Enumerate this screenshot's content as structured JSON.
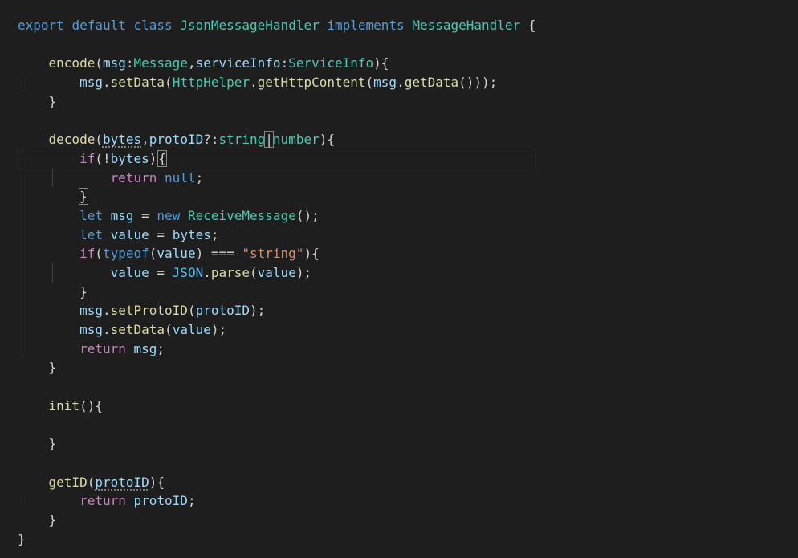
{
  "code": {
    "lines": [
      [
        {
          "t": "export",
          "c": "kw"
        },
        {
          "t": " ",
          "c": "pl"
        },
        {
          "t": "default",
          "c": "kw"
        },
        {
          "t": " ",
          "c": "pl"
        },
        {
          "t": "class",
          "c": "kw"
        },
        {
          "t": " ",
          "c": "pl"
        },
        {
          "t": "JsonMessageHandler",
          "c": "ty"
        },
        {
          "t": " ",
          "c": "pl"
        },
        {
          "t": "implements",
          "c": "kw"
        },
        {
          "t": " ",
          "c": "pl"
        },
        {
          "t": "MessageHandler",
          "c": "ty"
        },
        {
          "t": " {",
          "c": "pl"
        }
      ],
      [],
      [
        {
          "t": "    ",
          "c": "pl"
        },
        {
          "t": "encode",
          "c": "fn"
        },
        {
          "t": "(",
          "c": "pl"
        },
        {
          "t": "msg",
          "c": "vr"
        },
        {
          "t": ":",
          "c": "pl"
        },
        {
          "t": "Message",
          "c": "ty"
        },
        {
          "t": ",",
          "c": "pl"
        },
        {
          "t": "serviceInfo",
          "c": "vr"
        },
        {
          "t": ":",
          "c": "pl"
        },
        {
          "t": "ServiceInfo",
          "c": "ty"
        },
        {
          "t": "){",
          "c": "pl"
        }
      ],
      [
        {
          "t": "        ",
          "c": "pl"
        },
        {
          "t": "msg",
          "c": "vr"
        },
        {
          "t": ".",
          "c": "pl"
        },
        {
          "t": "setData",
          "c": "fn"
        },
        {
          "t": "(",
          "c": "pl"
        },
        {
          "t": "HttpHelper",
          "c": "ty"
        },
        {
          "t": ".",
          "c": "pl"
        },
        {
          "t": "getHttpContent",
          "c": "fn"
        },
        {
          "t": "(",
          "c": "pl"
        },
        {
          "t": "msg",
          "c": "vr"
        },
        {
          "t": ".",
          "c": "pl"
        },
        {
          "t": "getData",
          "c": "fn"
        },
        {
          "t": "()));",
          "c": "pl"
        }
      ],
      [
        {
          "t": "    }",
          "c": "pl"
        }
      ],
      [],
      [
        {
          "t": "    ",
          "c": "pl"
        },
        {
          "t": "decode",
          "c": "fn"
        },
        {
          "t": "(",
          "c": "pl"
        },
        {
          "t": "bytes",
          "c": "vr",
          "sq": true
        },
        {
          "t": ",",
          "c": "pl"
        },
        {
          "t": "protoID",
          "c": "vr"
        },
        {
          "t": "?:",
          "c": "pl"
        },
        {
          "t": "string",
          "c": "ty"
        },
        {
          "t": "|",
          "c": "pl",
          "bm": true
        },
        {
          "t": "number",
          "c": "ty"
        },
        {
          "t": "){",
          "c": "pl"
        }
      ],
      [
        {
          "t": "        ",
          "c": "pl"
        },
        {
          "t": "if",
          "c": "ctl"
        },
        {
          "t": "(!",
          "c": "pl"
        },
        {
          "t": "bytes",
          "c": "vr"
        },
        {
          "t": ")",
          "c": "pl"
        },
        {
          "t": "{",
          "c": "pl",
          "bm": true,
          "cur": true
        }
      ],
      [
        {
          "t": "            ",
          "c": "pl"
        },
        {
          "t": "return",
          "c": "ctl"
        },
        {
          "t": " ",
          "c": "pl"
        },
        {
          "t": "null",
          "c": "kw"
        },
        {
          "t": ";",
          "c": "pl"
        }
      ],
      [
        {
          "t": "        ",
          "c": "pl"
        },
        {
          "t": "}",
          "c": "pl",
          "bm": true
        }
      ],
      [
        {
          "t": "        ",
          "c": "pl"
        },
        {
          "t": "let",
          "c": "kw"
        },
        {
          "t": " ",
          "c": "pl"
        },
        {
          "t": "msg",
          "c": "vr"
        },
        {
          "t": " = ",
          "c": "pl"
        },
        {
          "t": "new",
          "c": "kw"
        },
        {
          "t": " ",
          "c": "pl"
        },
        {
          "t": "ReceiveMessage",
          "c": "ty"
        },
        {
          "t": "();",
          "c": "pl"
        }
      ],
      [
        {
          "t": "        ",
          "c": "pl"
        },
        {
          "t": "let",
          "c": "kw"
        },
        {
          "t": " ",
          "c": "pl"
        },
        {
          "t": "value",
          "c": "vr"
        },
        {
          "t": " = ",
          "c": "pl"
        },
        {
          "t": "bytes",
          "c": "vr"
        },
        {
          "t": ";",
          "c": "pl"
        }
      ],
      [
        {
          "t": "        ",
          "c": "pl"
        },
        {
          "t": "if",
          "c": "ctl"
        },
        {
          "t": "(",
          "c": "pl"
        },
        {
          "t": "typeof",
          "c": "kw"
        },
        {
          "t": "(",
          "c": "pl"
        },
        {
          "t": "value",
          "c": "vr"
        },
        {
          "t": ") === ",
          "c": "pl"
        },
        {
          "t": "\"string\"",
          "c": "str"
        },
        {
          "t": "){",
          "c": "pl"
        }
      ],
      [
        {
          "t": "            ",
          "c": "pl"
        },
        {
          "t": "value",
          "c": "vr"
        },
        {
          "t": " = ",
          "c": "pl"
        },
        {
          "t": "JSON",
          "c": "cnst"
        },
        {
          "t": ".",
          "c": "pl"
        },
        {
          "t": "parse",
          "c": "fn"
        },
        {
          "t": "(",
          "c": "pl"
        },
        {
          "t": "value",
          "c": "vr"
        },
        {
          "t": ");",
          "c": "pl"
        }
      ],
      [
        {
          "t": "        }",
          "c": "pl"
        }
      ],
      [
        {
          "t": "        ",
          "c": "pl"
        },
        {
          "t": "msg",
          "c": "vr"
        },
        {
          "t": ".",
          "c": "pl"
        },
        {
          "t": "setProtoID",
          "c": "fn"
        },
        {
          "t": "(",
          "c": "pl"
        },
        {
          "t": "protoID",
          "c": "vr"
        },
        {
          "t": ");",
          "c": "pl"
        }
      ],
      [
        {
          "t": "        ",
          "c": "pl"
        },
        {
          "t": "msg",
          "c": "vr"
        },
        {
          "t": ".",
          "c": "pl"
        },
        {
          "t": "setData",
          "c": "fn"
        },
        {
          "t": "(",
          "c": "pl"
        },
        {
          "t": "value",
          "c": "vr"
        },
        {
          "t": ");",
          "c": "pl"
        }
      ],
      [
        {
          "t": "        ",
          "c": "pl"
        },
        {
          "t": "return",
          "c": "ctl"
        },
        {
          "t": " ",
          "c": "pl"
        },
        {
          "t": "msg",
          "c": "vr"
        },
        {
          "t": ";",
          "c": "pl"
        }
      ],
      [
        {
          "t": "    }",
          "c": "pl"
        }
      ],
      [],
      [
        {
          "t": "    ",
          "c": "pl"
        },
        {
          "t": "init",
          "c": "fn"
        },
        {
          "t": "(){",
          "c": "pl"
        }
      ],
      [],
      [
        {
          "t": "    }",
          "c": "pl"
        }
      ],
      [],
      [
        {
          "t": "    ",
          "c": "pl"
        },
        {
          "t": "getID",
          "c": "fn"
        },
        {
          "t": "(",
          "c": "pl"
        },
        {
          "t": "protoID",
          "c": "vr",
          "sq": true
        },
        {
          "t": "){",
          "c": "pl"
        }
      ],
      [
        {
          "t": "        ",
          "c": "pl"
        },
        {
          "t": "return",
          "c": "ctl"
        },
        {
          "t": " ",
          "c": "pl"
        },
        {
          "t": "protoID",
          "c": "vr"
        },
        {
          "t": ";",
          "c": "pl"
        }
      ],
      [
        {
          "t": "    }",
          "c": "pl"
        }
      ],
      [
        {
          "t": "}",
          "c": "pl"
        }
      ]
    ],
    "guide_levels": [
      0,
      1,
      1,
      2,
      1,
      1,
      1,
      2,
      3,
      2,
      2,
      2,
      2,
      3,
      2,
      2,
      2,
      2,
      1,
      1,
      1,
      1,
      1,
      1,
      1,
      2,
      1,
      0
    ],
    "current_line": 7
  },
  "colors": {
    "background": "#1e1e1e",
    "keyword": "#569cd6",
    "control": "#c586c0",
    "function": "#dcdcaa",
    "type": "#4ec9b0",
    "variable": "#9cdcfe",
    "string": "#ce9178",
    "plain": "#d4d4d4"
  }
}
